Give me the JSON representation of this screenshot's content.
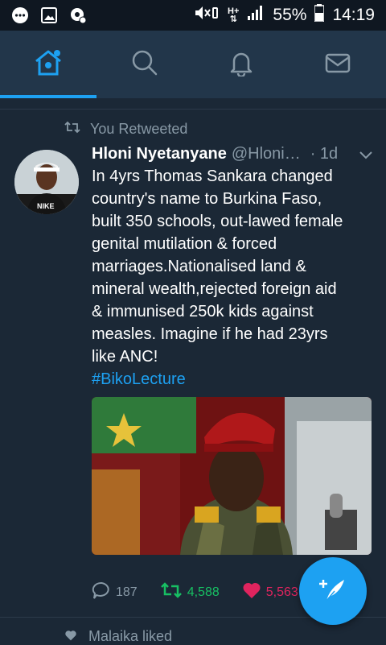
{
  "status_bar": {
    "battery": "55%",
    "time": "14:19",
    "icons": [
      "chat-bubble-icon",
      "image-icon",
      "settings-gear-icon",
      "mute-icon",
      "vibrate-icon",
      "network-hplus-icon",
      "signal-icon",
      "battery-icon"
    ]
  },
  "nav": {
    "tabs": [
      {
        "name": "home",
        "icon": "home-icon",
        "active": true
      },
      {
        "name": "search",
        "icon": "search-icon",
        "active": false
      },
      {
        "name": "notifications",
        "icon": "bell-icon",
        "active": false
      },
      {
        "name": "messages",
        "icon": "envelope-icon",
        "active": false
      }
    ]
  },
  "colors": {
    "accent": "#1da1f2",
    "retweet": "#17bf63",
    "like": "#e0245e",
    "background": "#1b2836",
    "nav_bg": "#22364a",
    "muted": "#8899a6"
  },
  "feed": {
    "retweet_label": "You Retweeted",
    "tweet": {
      "author_name": "Hloni Nyetanyane",
      "author_handle": "@Hloni…",
      "time": "· 1d",
      "lines": [
        "In 4yrs Thomas Sankara changed",
        "country's name to Burkina Faso,",
        "built 350 schools, out-lawed female",
        "genital mutilation & forced",
        "marriages.Nationalised land &",
        "mineral wealth,rejected foreign aid",
        "& immunised 250k kids against",
        "measles. Imagine if he had 23yrs",
        "like ANC!"
      ],
      "hashtag": "#BikoLecture",
      "replies": "187",
      "retweets": "4,588",
      "likes": "5,563",
      "liked_by_me": true,
      "retweeted_by_me": true
    },
    "next_item_label": "Malaika liked"
  }
}
